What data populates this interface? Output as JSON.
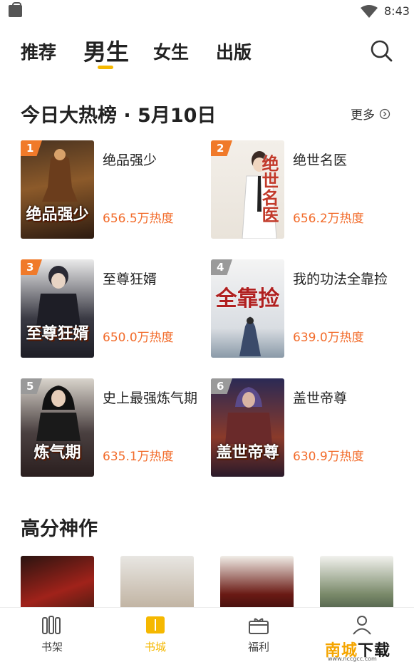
{
  "status_bar": {
    "time": "8:43"
  },
  "tabs": [
    {
      "label": "推荐"
    },
    {
      "label": "男生"
    },
    {
      "label": "女生"
    },
    {
      "label": "出版"
    }
  ],
  "hot_list": {
    "title": "今日大热榜 · 5月10日",
    "more_label": "更多",
    "books": [
      {
        "rank": "1",
        "title": "绝品强少",
        "heat": "656.5万热度",
        "cover_text": "绝品强少"
      },
      {
        "rank": "2",
        "title": "绝世名医",
        "heat": "656.2万热度",
        "cover_text": "绝世名医"
      },
      {
        "rank": "3",
        "title": "至尊狂婿",
        "heat": "650.0万热度",
        "cover_text": "至尊狂婿"
      },
      {
        "rank": "4",
        "title": "我的功法全靠捡",
        "heat": "639.0万热度",
        "cover_text": "全靠捡"
      },
      {
        "rank": "5",
        "title": "史上最强炼气期",
        "heat": "635.1万热度",
        "cover_text": "炼气期"
      },
      {
        "rank": "6",
        "title": "盖世帝尊",
        "heat": "630.9万热度",
        "cover_text": "盖世帝尊"
      }
    ]
  },
  "high_score": {
    "title": "高分神作"
  },
  "bottom_nav": [
    {
      "label": "书架"
    },
    {
      "label": "书城"
    },
    {
      "label": "福利"
    },
    {
      "label": "我的"
    }
  ],
  "watermark": {
    "text_a": "南城",
    "text_b": "下载",
    "url": "www.nccgcc.com"
  },
  "colors": {
    "accent": "#f5b800",
    "heat": "#f26b2a",
    "rank_top": "#f07a2a",
    "rank_other": "#9a9a9a"
  }
}
